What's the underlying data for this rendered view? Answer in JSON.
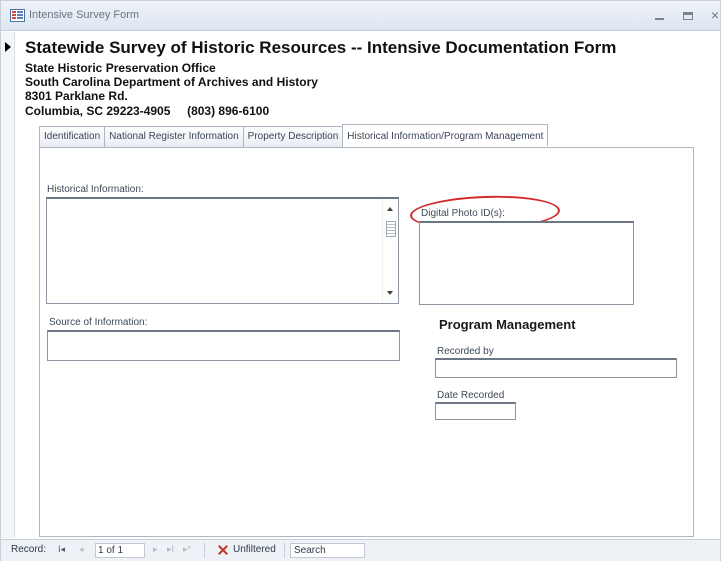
{
  "window": {
    "title": "Intensive Survey Form",
    "controls": {
      "minimize": "minimize",
      "maximize": "maximize",
      "close": "×"
    }
  },
  "header": {
    "title": "Statewide Survey of Historic Resources -- Intensive Documentation Form",
    "lines": [
      "State Historic Preservation Office",
      "South Carolina Department of Archives and History",
      "8301 Parklane Rd.",
      "Columbia, SC 29223-4905     (803) 896-6100"
    ]
  },
  "tabs": [
    {
      "label": "Identification",
      "active": false
    },
    {
      "label": "National Register Information",
      "active": false
    },
    {
      "label": "Property Description",
      "active": false
    },
    {
      "label": "Historical Information/Program Management",
      "active": true
    }
  ],
  "form": {
    "historical_information": {
      "label": "Historical Information:",
      "value": ""
    },
    "digital_photo": {
      "label": "Digital Photo ID(s):",
      "value": ""
    },
    "source_of_information": {
      "label": "Source of Information:",
      "value": ""
    },
    "program_management": {
      "title": "Program Management",
      "recorded_by": {
        "label": "Recorded by",
        "value": ""
      },
      "date_recorded": {
        "label": "Date Recorded",
        "value": ""
      }
    }
  },
  "annotation": {
    "color": "#d42a2a"
  },
  "statusbar": {
    "record_label": "Record:",
    "first": "I◂",
    "prev": "◂",
    "position": "1 of 1",
    "next": "▸",
    "last": "▸I",
    "new": "▸*",
    "filter": "Unfiltered",
    "search": "Search"
  }
}
